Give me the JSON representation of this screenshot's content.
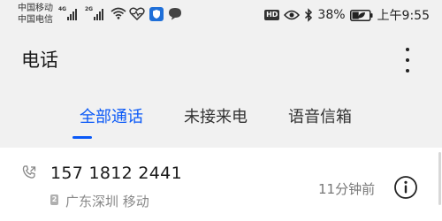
{
  "status_bar": {
    "carrier_1": "中国移动",
    "carrier_2": "中国电信",
    "sim1_network": "4G",
    "sim2_network": "2G",
    "hd_label": "HD",
    "battery_percent": "38%",
    "battery_level": 0.38,
    "time": "上午9:55"
  },
  "header": {
    "title": "电话"
  },
  "tabs": [
    {
      "label": "全部通话",
      "active": true
    },
    {
      "label": "未接来电",
      "active": false
    },
    {
      "label": "语音信箱",
      "active": false
    }
  ],
  "calls": [
    {
      "number": "157 1812 2441",
      "sim_label": "2",
      "location": "广东深圳 移动",
      "time": "11分钟前"
    }
  ],
  "colors": {
    "accent": "#0a59f7",
    "background": "#f1f1f1",
    "card": "#ffffff"
  },
  "icons": {
    "signal": "signal-bars-icon",
    "wifi": "wifi-icon",
    "health": "heart-rate-icon",
    "shield": "shield-icon",
    "message": "chat-bubble-icon",
    "eye": "eye-comfort-icon",
    "bluetooth": "bluetooth-icon",
    "battery": "battery-leaf-icon",
    "more": "more-vertical-icon",
    "phone": "outgoing-call-icon",
    "info": "info-icon"
  }
}
